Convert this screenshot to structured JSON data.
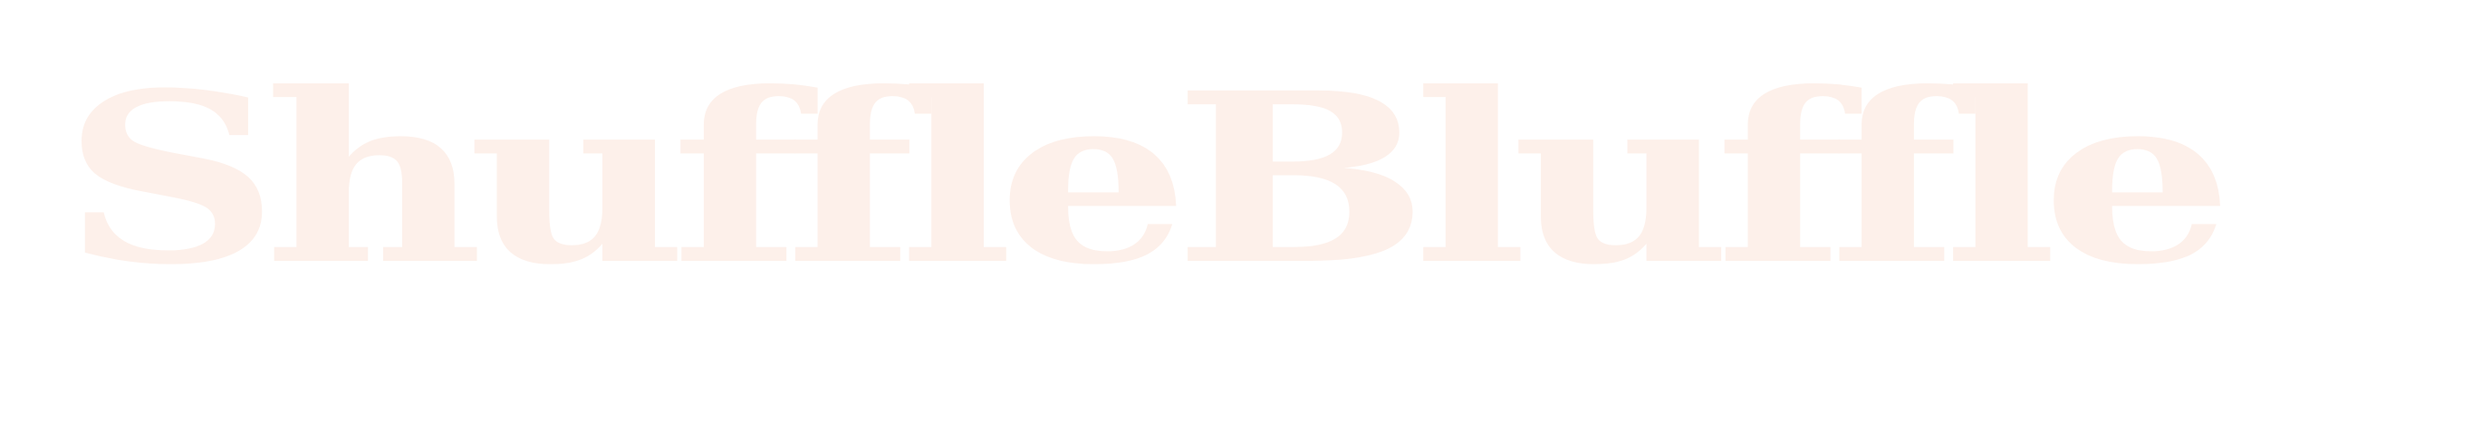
{
  "logo": {
    "wordmark": "ShuffleBluffle",
    "color": "#fdf0ea"
  }
}
